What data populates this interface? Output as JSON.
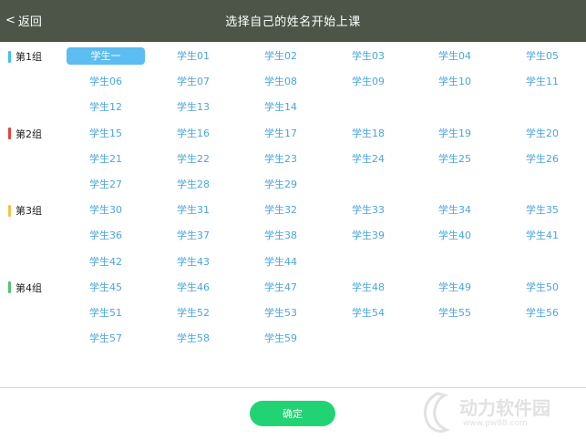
{
  "header": {
    "back_label": "返回",
    "title": "选择自己的姓名开始上课"
  },
  "colors": {
    "group1": "#3ec1ea",
    "group2": "#e0453c",
    "group3": "#f3c343",
    "group4": "#52c46a"
  },
  "groups": [
    {
      "label": "第1组",
      "rows": [
        [
          "学生一",
          "学生01",
          "学生02",
          "学生03",
          "学生04",
          "学生05"
        ],
        [
          "学生06",
          "学生07",
          "学生08",
          "学生09",
          "学生10",
          "学生11"
        ],
        [
          "学生12",
          "学生13",
          "学生14"
        ]
      ]
    },
    {
      "label": "第2组",
      "rows": [
        [
          "学生15",
          "学生16",
          "学生17",
          "学生18",
          "学生19",
          "学生20"
        ],
        [
          "学生21",
          "学生22",
          "学生23",
          "学生24",
          "学生25",
          "学生26"
        ],
        [
          "学生27",
          "学生28",
          "学生29"
        ]
      ]
    },
    {
      "label": "第3组",
      "rows": [
        [
          "学生30",
          "学生31",
          "学生32",
          "学生33",
          "学生34",
          "学生35"
        ],
        [
          "学生36",
          "学生37",
          "学生38",
          "学生39",
          "学生40",
          "学生41"
        ],
        [
          "学生42",
          "学生43",
          "学生44"
        ]
      ]
    },
    {
      "label": "第4组",
      "rows": [
        [
          "学生45",
          "学生46",
          "学生47",
          "学生48",
          "学生49",
          "学生50"
        ],
        [
          "学生51",
          "学生52",
          "学生53",
          "学生54",
          "学生55",
          "学生56"
        ],
        [
          "学生57",
          "学生58",
          "学生59"
        ]
      ]
    }
  ],
  "selected_student": "学生一",
  "confirm_label": "确定",
  "watermark": {
    "text": "动力软件园",
    "url": "www.pw88.com"
  }
}
